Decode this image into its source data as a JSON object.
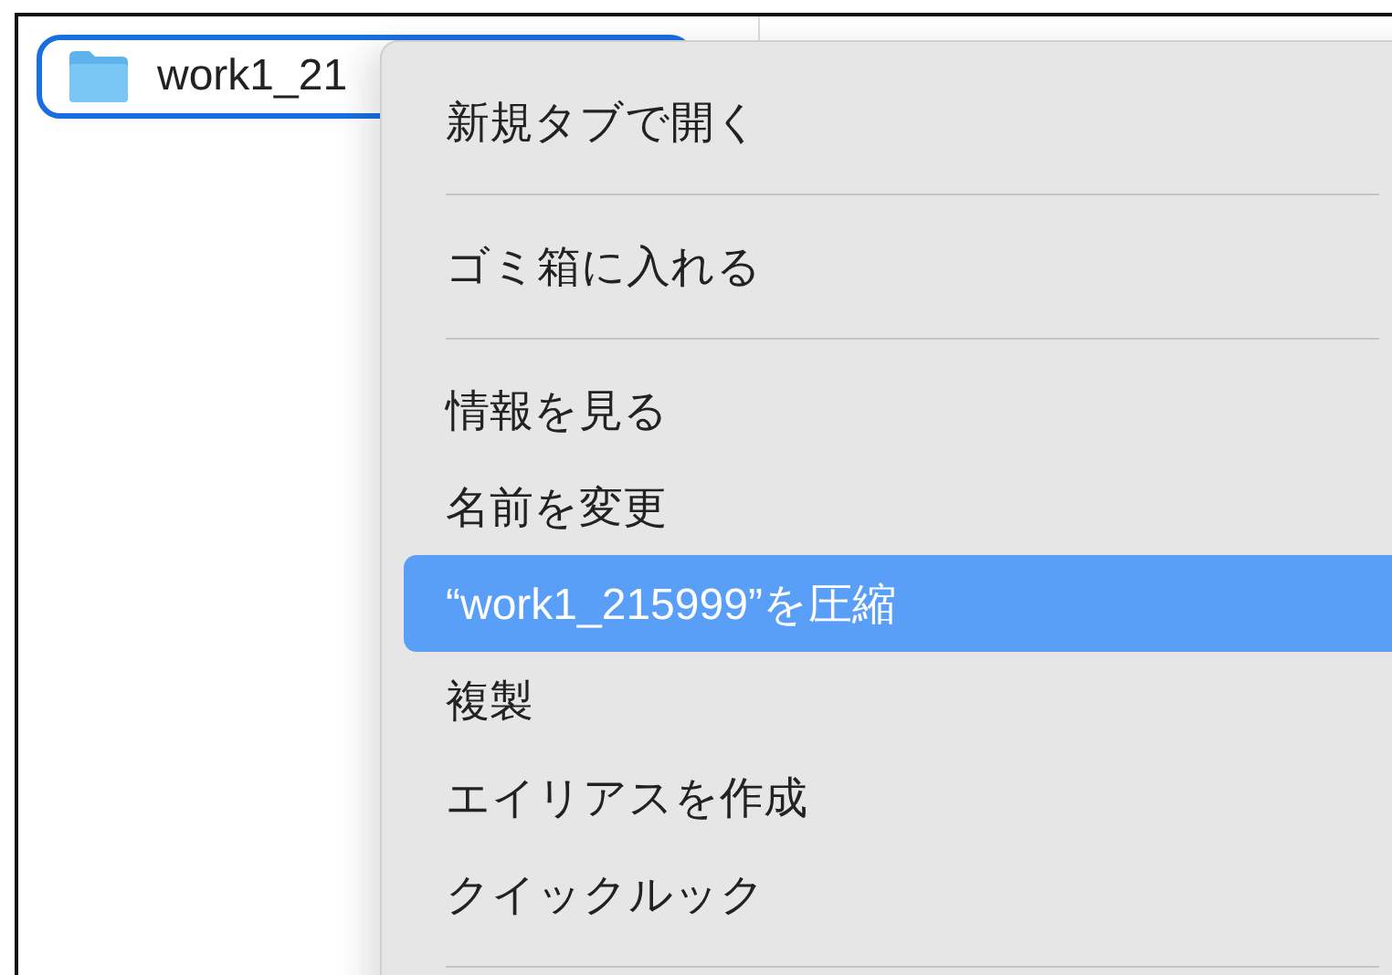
{
  "file_item": {
    "name": "work1_21",
    "selected": true
  },
  "context_menu": {
    "items": [
      {
        "kind": "item",
        "label": "新規タブで開く",
        "selected": false
      },
      {
        "kind": "separator"
      },
      {
        "kind": "item",
        "label": "ゴミ箱に入れる",
        "selected": false
      },
      {
        "kind": "separator"
      },
      {
        "kind": "item",
        "label": "情報を見る",
        "selected": false
      },
      {
        "kind": "item",
        "label": "名前を変更",
        "selected": false
      },
      {
        "kind": "item",
        "label": "“work1_215999”を圧縮",
        "selected": true
      },
      {
        "kind": "item",
        "label": "複製",
        "selected": false
      },
      {
        "kind": "item",
        "label": "エイリアスを作成",
        "selected": false
      },
      {
        "kind": "item",
        "label": "クイックルック",
        "selected": false
      },
      {
        "kind": "separator"
      }
    ]
  }
}
